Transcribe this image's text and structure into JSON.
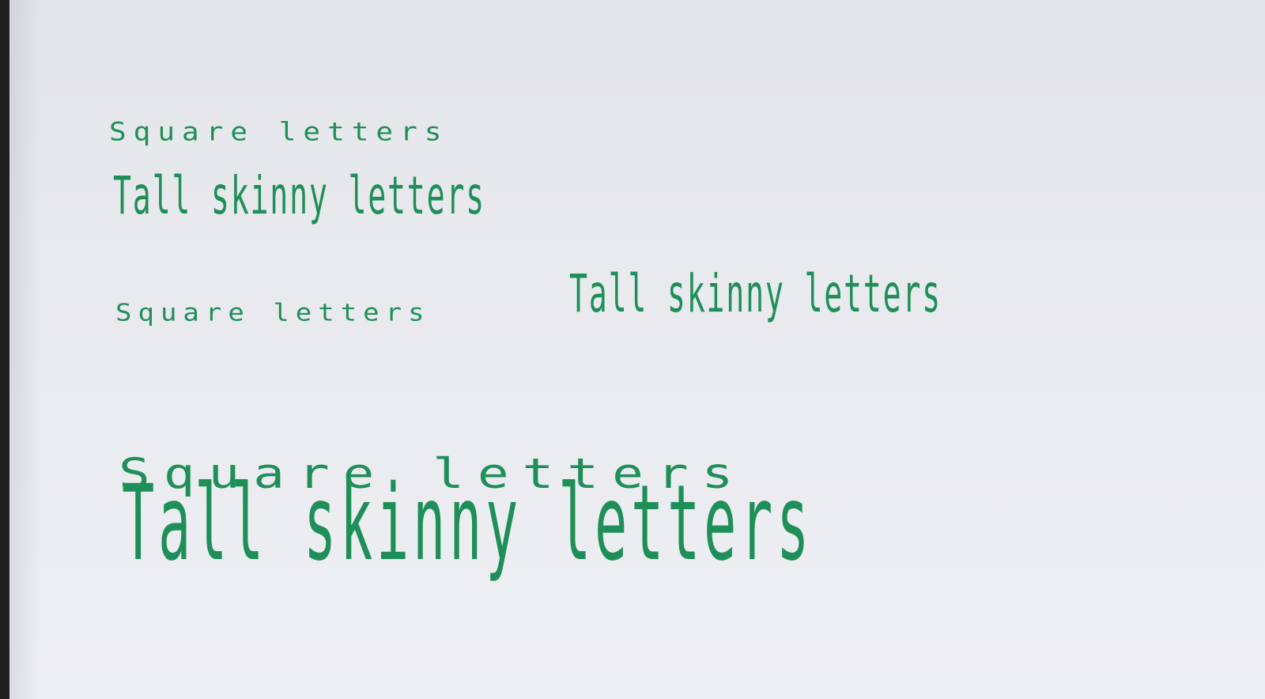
{
  "lines": {
    "row1_square": "Square letters",
    "row2_skinny": "Tall skinny letters",
    "row3_square": "Square letters",
    "row3_skinny": "Tall skinny letters",
    "row4_square": "Square letters",
    "row4_skinny": "Tall skinny letters"
  },
  "colors": {
    "ink": "#1f8f5a",
    "paper": "#e9eaee"
  }
}
